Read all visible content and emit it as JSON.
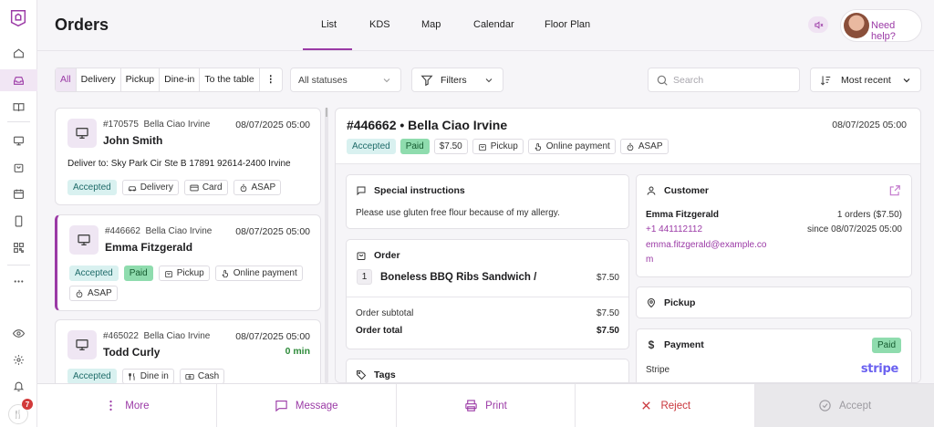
{
  "header": {
    "title": "Orders",
    "tabs": [
      {
        "label": "List",
        "active": true
      },
      {
        "label": "KDS"
      },
      {
        "label": "Map"
      },
      {
        "label": "Calendar"
      },
      {
        "label": "Floor Plan"
      }
    ],
    "help_label": "Need help?"
  },
  "filters": {
    "types": [
      "All",
      "Delivery",
      "Pickup",
      "Dine-in",
      "To the table"
    ],
    "status_select": "All statuses",
    "filters_label": "Filters",
    "search_placeholder": "Search",
    "sort_label": "Most recent"
  },
  "orders": [
    {
      "number": "#170575",
      "location": "Bella Ciao Irvine",
      "date": "08/07/2025 05:00",
      "name": "John Smith",
      "address": "Deliver to: Sky Park Cir Ste B 17891 92614-2400 Irvine",
      "chips": [
        {
          "label": "Accepted",
          "style": "teal"
        },
        {
          "label": "Delivery",
          "icon": "car-icon"
        },
        {
          "label": "Card",
          "icon": "card-icon"
        },
        {
          "label": "ASAP",
          "icon": "stopwatch-icon"
        }
      ]
    },
    {
      "number": "#446662",
      "location": "Bella Ciao Irvine",
      "date": "08/07/2025 05:00",
      "name": "Emma Fitzgerald",
      "chips": [
        {
          "label": "Accepted",
          "style": "teal"
        },
        {
          "label": "Paid",
          "style": "green"
        },
        {
          "label": "Pickup",
          "icon": "bag-icon"
        },
        {
          "label": "Online payment",
          "icon": "hand-tap-icon"
        },
        {
          "label": "ASAP",
          "icon": "stopwatch-icon"
        }
      ]
    },
    {
      "number": "#465022",
      "location": "Bella Ciao Irvine",
      "date": "08/07/2025 05:00",
      "name": "Todd Curly",
      "elapsed": "0 min",
      "chips": [
        {
          "label": "Accepted",
          "style": "teal"
        },
        {
          "label": "Dine in",
          "icon": "cutlery-icon"
        },
        {
          "label": "Cash",
          "icon": "cash-icon"
        }
      ]
    }
  ],
  "detail": {
    "title": "#446662 • Bella Ciao Irvine",
    "date": "08/07/2025 05:00",
    "chips": [
      {
        "label": "Accepted",
        "style": "teal"
      },
      {
        "label": "Paid",
        "style": "green"
      },
      {
        "label": "$7.50"
      },
      {
        "label": "Pickup",
        "icon": "bag-icon"
      },
      {
        "label": "Online payment",
        "icon": "hand-tap-icon"
      },
      {
        "label": "ASAP",
        "icon": "stopwatch-icon"
      }
    ],
    "special": {
      "title": "Special instructions",
      "text": "Please use gluten free flour because of my allergy."
    },
    "order": {
      "title": "Order",
      "item_qty": "1",
      "item_name": "Boneless BBQ Ribs Sandwich /",
      "item_price": "$7.50",
      "subtotal_label": "Order subtotal",
      "subtotal": "$7.50",
      "total_label": "Order total",
      "total": "$7.50"
    },
    "tags_title": "Tags",
    "customer": {
      "title": "Customer",
      "name": "Emma Fitzgerald",
      "orders": "1 orders ($7.50)",
      "phone": "+1 441112112",
      "since": "since 08/07/2025 05:00",
      "email_line1": "emma.fitzgerald@example.co",
      "email_line2": "m"
    },
    "pickup_title": "Pickup",
    "payment": {
      "title": "Payment",
      "status": "Paid",
      "provider": "Stripe",
      "logo": "stripe"
    }
  },
  "actions": {
    "more": "More",
    "message": "Message",
    "print": "Print",
    "reject": "Reject",
    "accept": "Accept"
  },
  "notifications_count": "7",
  "colors": {
    "accent": "#9b3aa6",
    "teal_chip": "#d9f1f0",
    "paid_chip": "#8fdcae",
    "reject": "#c9363c"
  }
}
